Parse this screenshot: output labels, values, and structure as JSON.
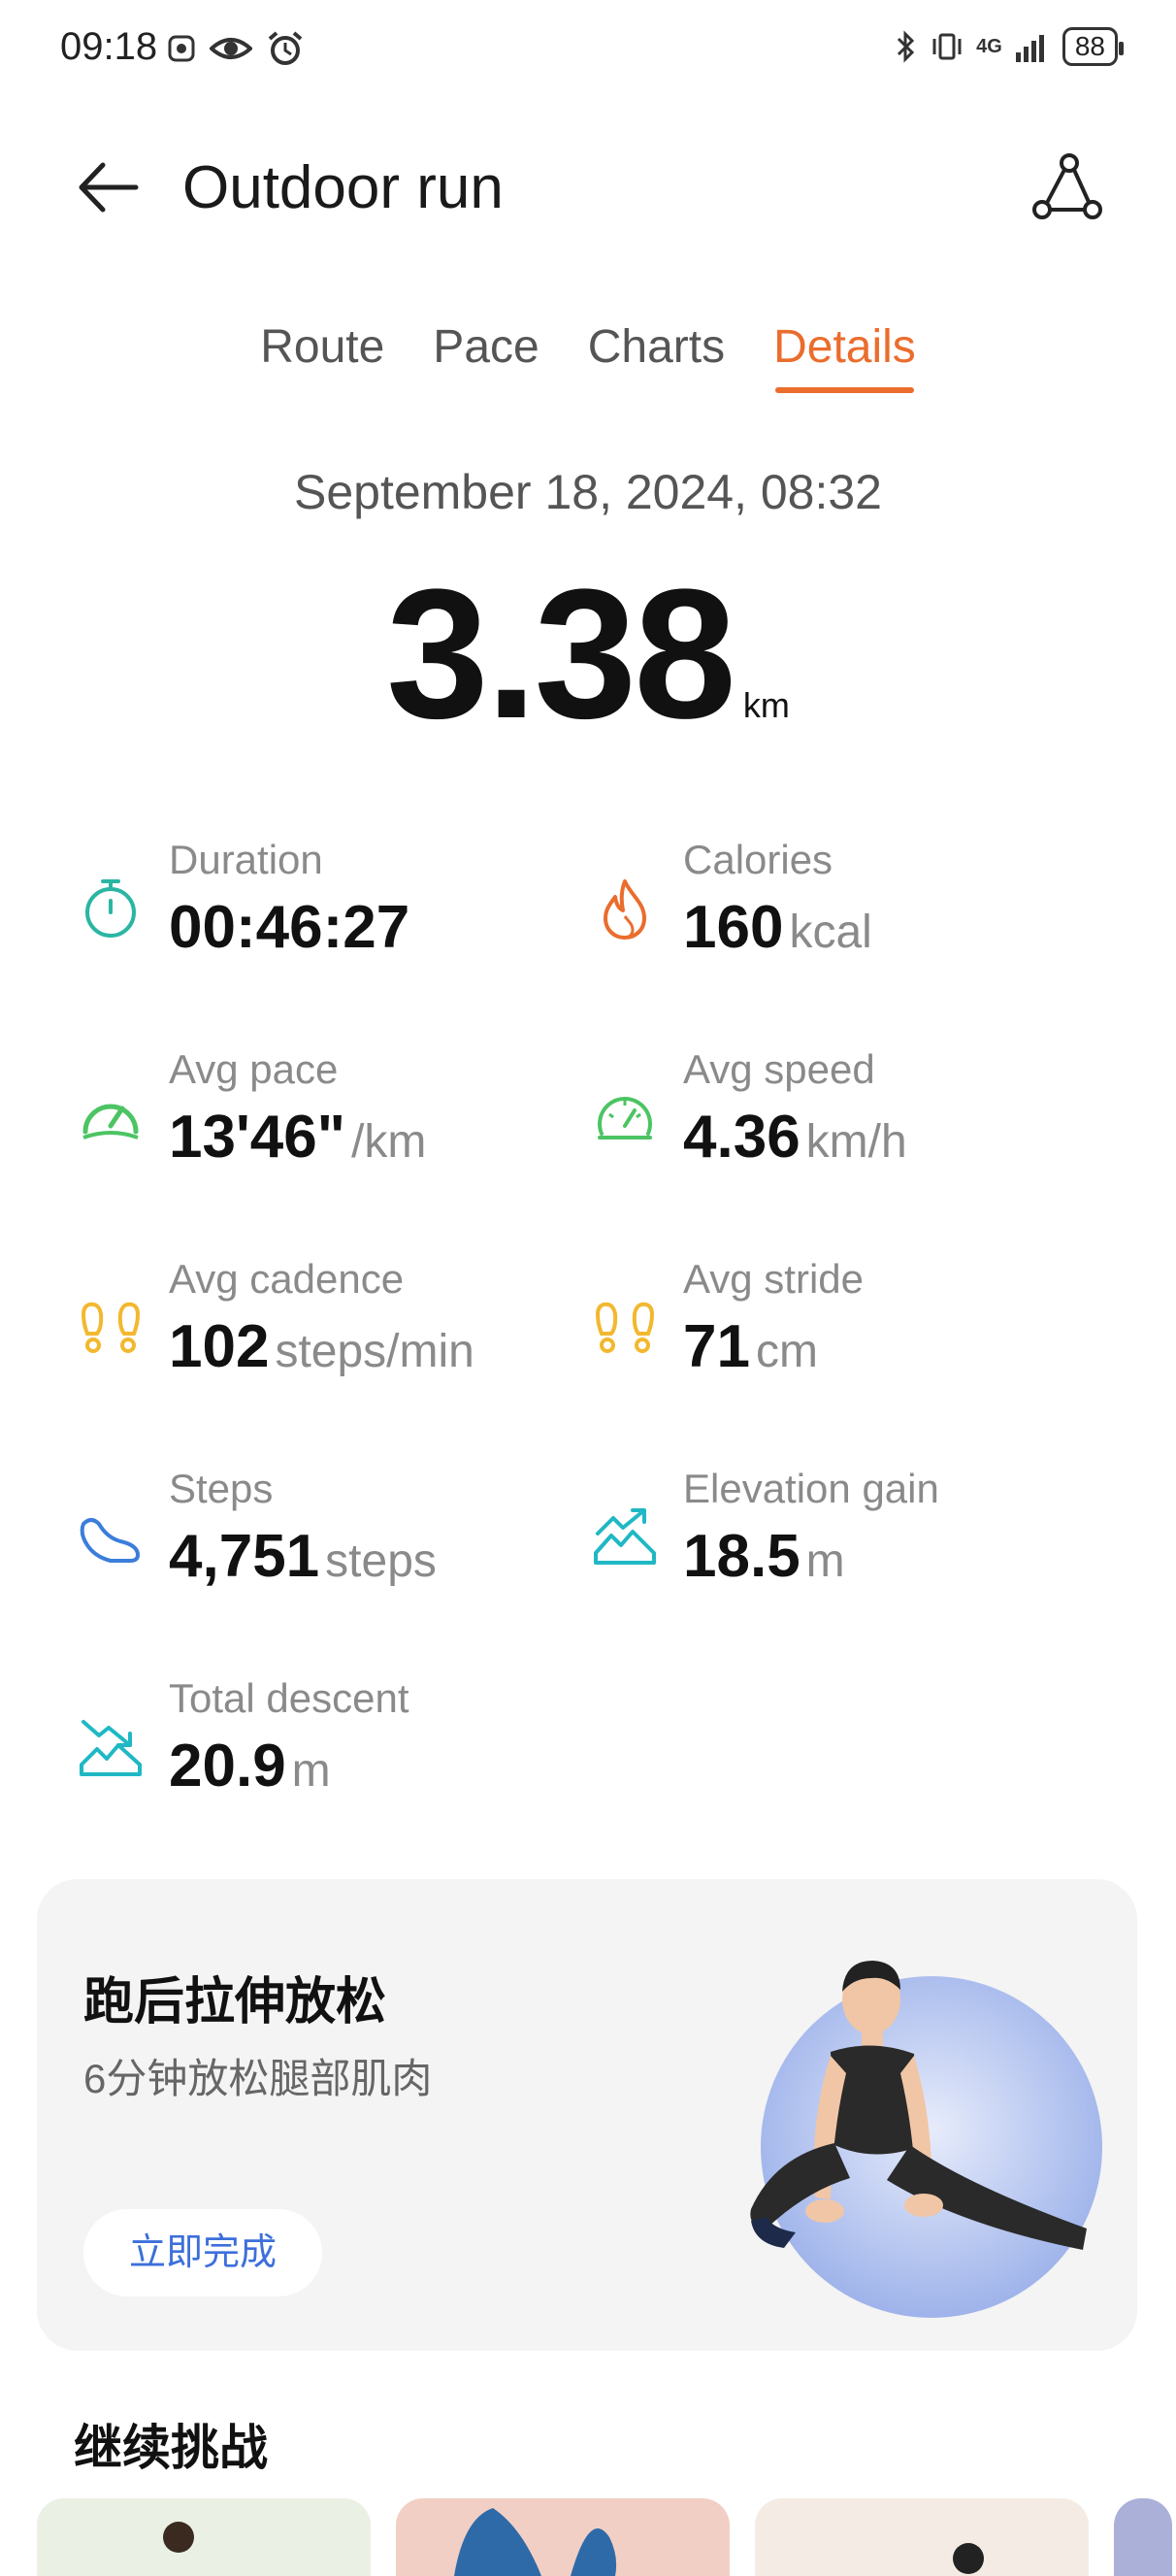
{
  "status_bar": {
    "time": "09:18",
    "network": "4G",
    "battery": "88"
  },
  "header": {
    "title": "Outdoor run"
  },
  "tabs": [
    {
      "label": "Route",
      "active": false
    },
    {
      "label": "Pace",
      "active": false
    },
    {
      "label": "Charts",
      "active": false
    },
    {
      "label": "Details",
      "active": true
    }
  ],
  "workout": {
    "date": "September 18, 2024, 08:32",
    "distance": "3.38",
    "distance_unit": "km"
  },
  "metrics": [
    {
      "label": "Duration",
      "value": "00:46:27",
      "unit": "",
      "icon": "stopwatch-icon",
      "color": "#2ab6a3"
    },
    {
      "label": "Calories",
      "value": "160",
      "unit": "kcal",
      "icon": "flame-icon",
      "color": "#ea6d2d"
    },
    {
      "label": "Avg pace",
      "value": "13'46\"",
      "unit": "/km",
      "icon": "speedometer-icon",
      "color": "#4cc463"
    },
    {
      "label": "Avg speed",
      "value": "4.36",
      "unit": "km/h",
      "icon": "gauge-icon",
      "color": "#4cc463"
    },
    {
      "label": "Avg cadence",
      "value": "102",
      "unit": "steps/min",
      "icon": "footprints-icon",
      "color": "#f2b82e"
    },
    {
      "label": "Avg stride",
      "value": "71",
      "unit": "cm",
      "icon": "footprints-icon",
      "color": "#f2b82e"
    },
    {
      "label": "Steps",
      "value": "4,751",
      "unit": "steps",
      "icon": "shoe-icon",
      "color": "#3c7ddb"
    },
    {
      "label": "Elevation gain",
      "value": "18.5",
      "unit": "m",
      "icon": "elevation-up-icon",
      "color": "#1fb8c4"
    },
    {
      "label": "Total descent",
      "value": "20.9",
      "unit": "m",
      "icon": "elevation-down-icon",
      "color": "#1fb8c4"
    }
  ],
  "stretch_card": {
    "title": "跑后拉伸放松",
    "subtitle": "6分钟放松腿部肌肉",
    "button": "立即完成"
  },
  "challenge_section": {
    "title": "继续挑战"
  },
  "colors": {
    "accent": "#ea6d2d",
    "link": "#3c6fdb"
  }
}
